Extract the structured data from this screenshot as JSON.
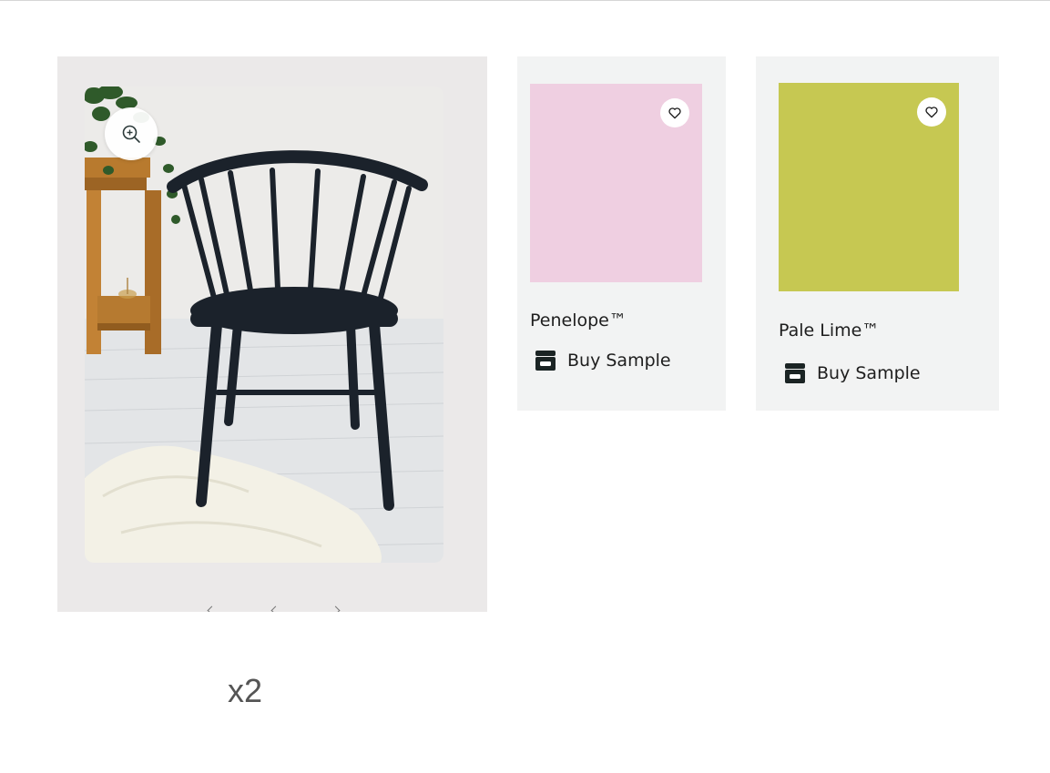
{
  "gallery": {
    "photo_alt": "Black spindle-back chair in a white room",
    "zoom_icon": "zoom-in-icon",
    "multiplier": "x2"
  },
  "swatches": [
    {
      "name": "Penelope™",
      "color": "#efcfe1",
      "buy_label": "Buy Sample",
      "favorite_icon": "heart-icon",
      "buy_icon": "sample-pot-icon"
    },
    {
      "name": "Pale Lime™",
      "color": "#c6c852",
      "buy_label": "Buy Sample",
      "favorite_icon": "heart-icon",
      "buy_icon": "sample-pot-icon"
    }
  ],
  "colors": {
    "gallery_bg": "#ebe9e9",
    "card_bg": "#f2f3f3",
    "text": "#1e1e1e"
  }
}
